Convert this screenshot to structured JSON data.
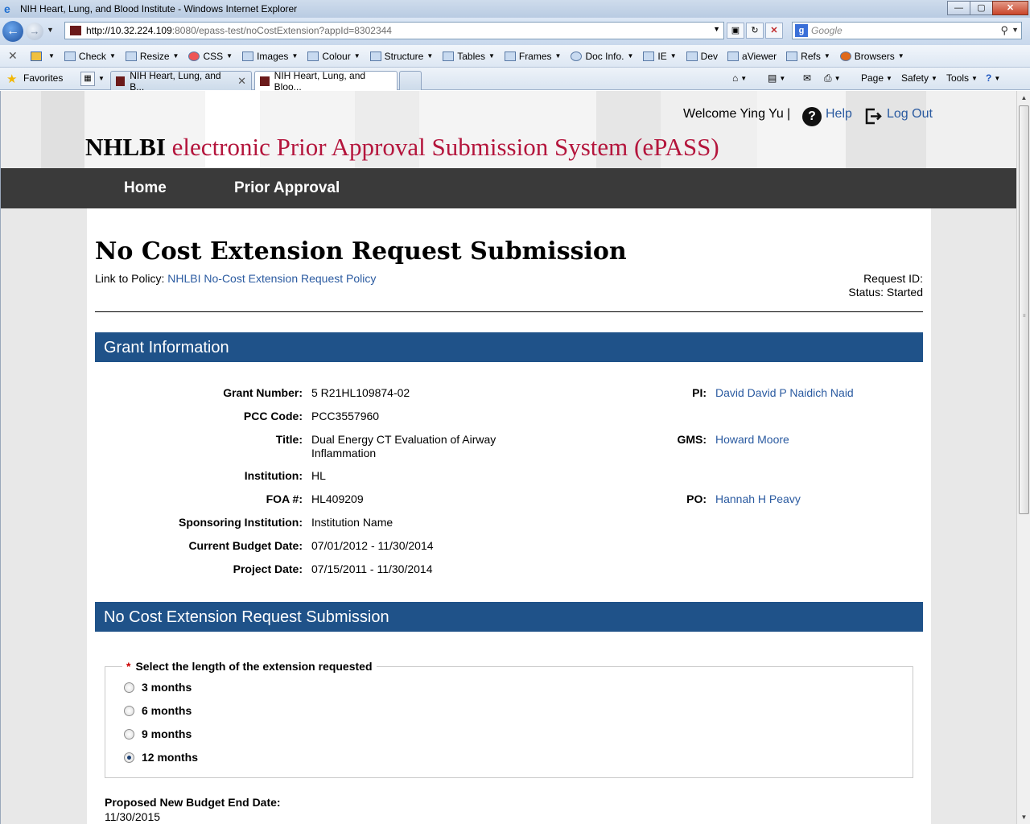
{
  "window": {
    "title": "NIH Heart, Lung, and Blood Institute - Windows Internet Explorer",
    "min": "—",
    "max": "▢",
    "close": "✕"
  },
  "address": {
    "url_host": "http://10.32.224.109",
    "url_path": ":8080/epass-test/noCostExtension?appId=8302344",
    "search_placeholder": "Google"
  },
  "toolbar": {
    "items": [
      "Check",
      "Resize",
      "CSS",
      "Images",
      "Colour",
      "Structure",
      "Tables",
      "Frames",
      "Doc Info.",
      "IE",
      "Dev",
      "aViewer",
      "Refs",
      "Browsers"
    ]
  },
  "favorites": {
    "label": "Favorites",
    "tabs": [
      "NIH Heart, Lung, and B...",
      "NIH Heart, Lung, and Bloo..."
    ],
    "commands": [
      "Page",
      "Safety",
      "Tools"
    ]
  },
  "header": {
    "welcome": "Welcome Ying Yu",
    "separator": "|",
    "help": "Help",
    "logout": "Log Out",
    "title_strong": "NHLBI",
    "title_rest": "electronic Prior Approval Submission System (ePASS)"
  },
  "nav": {
    "home": "Home",
    "prior_approval": "Prior Approval"
  },
  "page": {
    "title": "No Cost Extension Request Submission",
    "policy_label": "Link to Policy:",
    "policy_link": "NHLBI No-Cost Extension Request Policy",
    "request_id_label": "Request ID:",
    "status": "Status: Started"
  },
  "grant": {
    "section_title": "Grant Information",
    "fields": [
      {
        "label": "Grant Number:",
        "value": "5 R21HL109874-02"
      },
      {
        "label": "PCC Code:",
        "value": "PCC3557960"
      },
      {
        "label": "Title:",
        "value": "Dual Energy CT Evaluation of Airway\nInflammation"
      },
      {
        "label": "Institution:",
        "value": "HL"
      },
      {
        "label": "FOA #:",
        "value": "HL409209"
      },
      {
        "label": "Sponsoring Institution:",
        "value": "Institution Name"
      },
      {
        "label": "Current Budget Date:",
        "value": "07/01/2012 - 11/30/2014"
      },
      {
        "label": "Project Date:",
        "value": "07/15/2011 - 11/30/2014"
      }
    ],
    "people": [
      {
        "label": "PI:",
        "value": "David David P Naidich Naid"
      },
      {
        "label": "GMS:",
        "value": "Howard Moore"
      },
      {
        "label": "PO:",
        "value": "Hannah H Peavy"
      }
    ]
  },
  "submission": {
    "section_title": "No Cost Extension Request Submission",
    "required_mark": "*",
    "legend": "Select the length of the extension requested",
    "options": [
      {
        "label": "3 months",
        "selected": false
      },
      {
        "label": "6 months",
        "selected": false
      },
      {
        "label": "9 months",
        "selected": false
      },
      {
        "label": "12 months",
        "selected": true
      }
    ],
    "proposed_label": "Proposed New Budget End Date:",
    "proposed_value": "11/30/2015"
  },
  "colors": {
    "section_bar": "#1f5289",
    "nav_bar": "#3a3a3a",
    "title_accent": "#b4153c",
    "link": "#2a5aa0"
  }
}
